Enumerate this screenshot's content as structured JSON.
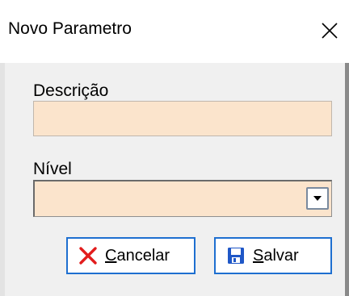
{
  "window": {
    "title": "Novo Parametro"
  },
  "form": {
    "descricao_label": "Descrição",
    "descricao_value": "",
    "nivel_label": "Nível",
    "nivel_value": ""
  },
  "buttons": {
    "cancel_label": "Cancelar",
    "save_label": "Salvar"
  },
  "icons": {
    "close": "close-icon",
    "dropdown": "chevron-down-icon",
    "cancel": "red-x-icon",
    "save": "floppy-disk-icon"
  },
  "colors": {
    "field_background": "#fbe4cc",
    "button_border": "#1e6fd0",
    "cancel_icon": "#e21c1c",
    "save_icon": "#1f57c7"
  }
}
